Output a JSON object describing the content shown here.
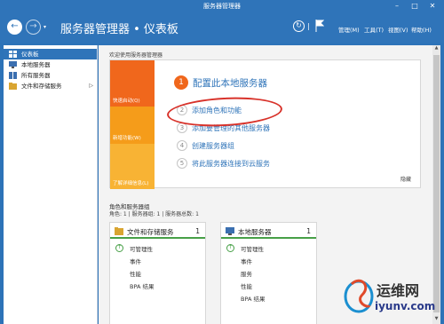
{
  "window": {
    "title": "服务器管理器",
    "minimize": "–",
    "maximize": "□",
    "close": "✕"
  },
  "header": {
    "breadcrumb": "服务器管理器 • 仪表板",
    "menus": [
      "管理(M)",
      "工具(T)",
      "视图(V)",
      "帮助(H)"
    ]
  },
  "sidebar": {
    "items": [
      {
        "label": "仪表板",
        "icon": "dashboard-icon",
        "active": true
      },
      {
        "label": "本地服务器",
        "icon": "server-icon"
      },
      {
        "label": "所有服务器",
        "icon": "servers-icon"
      },
      {
        "label": "文件和存储服务",
        "icon": "storage-icon",
        "arrow": "▷"
      }
    ]
  },
  "welcome": {
    "label": "欢迎使用服务器管理器",
    "tiles": [
      "快速启动(Q)",
      "新增功能(W)",
      "了解详细信息(L)"
    ],
    "steps": [
      {
        "num": "1",
        "text": "配置此本地服务器"
      },
      {
        "num": "2",
        "text": "添加角色和功能"
      },
      {
        "num": "3",
        "text": "添加要管理的其他服务器"
      },
      {
        "num": "4",
        "text": "创建服务器组"
      },
      {
        "num": "5",
        "text": "将此服务器连接到云服务"
      }
    ],
    "hide": "隐藏"
  },
  "groups": {
    "label": "角色和服务器组",
    "summary": "角色: 1 | 服务器组: 1 | 服务器总数: 1",
    "cards": [
      {
        "title": "文件和存储服务",
        "count": "1",
        "rows": [
          "可管理性",
          "事件",
          "性能",
          "BPA 结果"
        ]
      },
      {
        "title": "本地服务器",
        "count": "1",
        "rows": [
          "可管理性",
          "事件",
          "服务",
          "性能",
          "BPA 结果"
        ]
      }
    ]
  },
  "watermark": {
    "name": "运维网",
    "url": "iyunv.com"
  },
  "colors": {
    "header": "#2f74b9",
    "accent_orange": "#f0671c",
    "status_green": "#47a047",
    "annotation_red": "#d8322a"
  }
}
